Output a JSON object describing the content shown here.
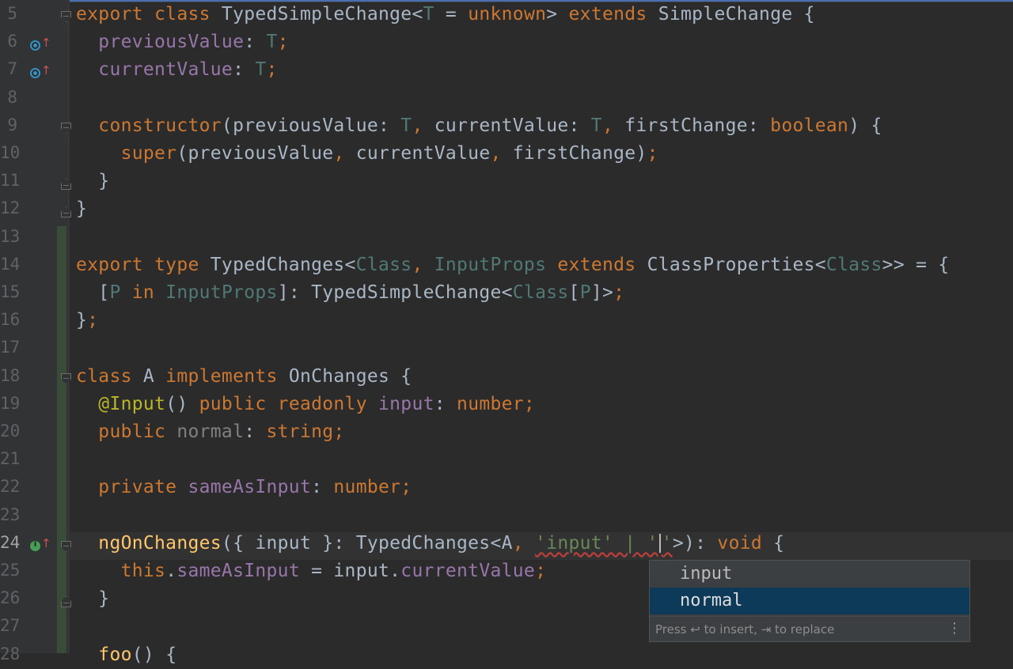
{
  "editor": {
    "lines": [
      {
        "n": "5",
        "tokens": [
          [
            "kw",
            "export class "
          ],
          [
            "cls",
            "TypedSimpleChange"
          ],
          [
            "",
            "<"
          ],
          [
            "tp",
            "T"
          ],
          [
            "",
            " = "
          ],
          [
            "kw",
            "unknown"
          ],
          [
            "",
            "> "
          ],
          [
            "kw",
            "extends "
          ],
          [
            "cls",
            "SimpleChange {"
          ]
        ]
      },
      {
        "n": "6",
        "tokens": [
          [
            "",
            "  "
          ],
          [
            "fld",
            "previousValue"
          ],
          [
            "",
            ": "
          ],
          [
            "tp",
            "T"
          ],
          [
            "kw",
            ";"
          ]
        ]
      },
      {
        "n": "7",
        "tokens": [
          [
            "",
            "  "
          ],
          [
            "fld",
            "currentValue"
          ],
          [
            "",
            ": "
          ],
          [
            "tp",
            "T"
          ],
          [
            "kw",
            ";"
          ]
        ]
      },
      {
        "n": "8",
        "tokens": []
      },
      {
        "n": "9",
        "tokens": [
          [
            "",
            "  "
          ],
          [
            "kw",
            "constructor"
          ],
          [
            "",
            "(previousValue: "
          ],
          [
            "tp",
            "T"
          ],
          [
            "kw",
            ", "
          ],
          [
            "",
            "currentValue: "
          ],
          [
            "tp",
            "T"
          ],
          [
            "kw",
            ", "
          ],
          [
            "",
            "firstChange: "
          ],
          [
            "kw",
            "boolean"
          ],
          [
            "",
            ") {"
          ]
        ]
      },
      {
        "n": "10",
        "tokens": [
          [
            "",
            "    "
          ],
          [
            "kw",
            "super"
          ],
          [
            "",
            "(previousValue"
          ],
          [
            "kw",
            ", "
          ],
          [
            "",
            "currentValue"
          ],
          [
            "kw",
            ", "
          ],
          [
            "",
            "firstChange)"
          ],
          [
            "kw",
            ";"
          ]
        ]
      },
      {
        "n": "11",
        "tokens": [
          [
            "",
            "  }"
          ]
        ]
      },
      {
        "n": "12",
        "tokens": [
          [
            "",
            "}"
          ]
        ]
      },
      {
        "n": "13",
        "tokens": []
      },
      {
        "n": "14",
        "tokens": [
          [
            "kw",
            "export type "
          ],
          [
            "",
            "TypedChanges<"
          ],
          [
            "tp",
            "Class"
          ],
          [
            "kw",
            ", "
          ],
          [
            "tp",
            "InputProps "
          ],
          [
            "kw",
            "extends "
          ],
          [
            "",
            "ClassProperties<"
          ],
          [
            "tp",
            "Class"
          ],
          [
            "",
            ">> = {"
          ]
        ]
      },
      {
        "n": "15",
        "tokens": [
          [
            "",
            "  ["
          ],
          [
            "tp",
            "P "
          ],
          [
            "kw",
            "in "
          ],
          [
            "tp",
            "InputProps"
          ],
          [
            "",
            "]: TypedSimpleChange<"
          ],
          [
            "tp",
            "Class"
          ],
          [
            "",
            "["
          ],
          [
            "tp",
            "P"
          ],
          [
            "",
            "]>"
          ],
          [
            "kw",
            ";"
          ]
        ]
      },
      {
        "n": "16",
        "tokens": [
          [
            "",
            "}"
          ],
          [
            "kw",
            ";"
          ]
        ]
      },
      {
        "n": "17",
        "tokens": []
      },
      {
        "n": "18",
        "tokens": [
          [
            "kw",
            "class "
          ],
          [
            "",
            "A "
          ],
          [
            "kw",
            "implements "
          ],
          [
            "",
            "OnChanges {"
          ]
        ]
      },
      {
        "n": "19",
        "tokens": [
          [
            "",
            "  "
          ],
          [
            "ann",
            "@Input"
          ],
          [
            "",
            "() "
          ],
          [
            "kw",
            "public readonly "
          ],
          [
            "fld",
            "input"
          ],
          [
            "",
            ": "
          ],
          [
            "kw",
            "number;"
          ]
        ]
      },
      {
        "n": "20",
        "tokens": [
          [
            "",
            "  "
          ],
          [
            "kw",
            "public "
          ],
          [
            "dim",
            "normal"
          ],
          [
            "",
            ": "
          ],
          [
            "kw",
            "string;"
          ]
        ]
      },
      {
        "n": "21",
        "tokens": []
      },
      {
        "n": "22",
        "tokens": [
          [
            "",
            "  "
          ],
          [
            "kw",
            "private "
          ],
          [
            "fld",
            "sameAsInput"
          ],
          [
            "",
            ": "
          ],
          [
            "kw",
            "number;"
          ]
        ]
      },
      {
        "n": "23",
        "tokens": []
      },
      {
        "n": "24",
        "tokens": [
          [
            "",
            "  "
          ],
          [
            "fn",
            "ngOnChanges"
          ],
          [
            "",
            "({ input }: TypedChanges<A"
          ],
          [
            "kw",
            ", "
          ],
          [
            "str err",
            "'input' | ''"
          ],
          [
            "",
            ">)"
          ],
          [
            "",
            ": "
          ],
          [
            "kw",
            "void "
          ],
          [
            "",
            "{"
          ]
        ]
      },
      {
        "n": "25",
        "tokens": [
          [
            "",
            "    "
          ],
          [
            "kw",
            "this"
          ],
          [
            "",
            "."
          ],
          [
            "fld",
            "sameAsInput"
          ],
          [
            "",
            " = input."
          ],
          [
            "fld",
            "currentValue"
          ],
          [
            "kw",
            ";"
          ]
        ]
      },
      {
        "n": "26",
        "tokens": [
          [
            "",
            "  }"
          ]
        ]
      },
      {
        "n": "27",
        "tokens": []
      },
      {
        "n": "28",
        "tokens": [
          [
            "",
            "  "
          ],
          [
            "fn",
            "foo"
          ],
          [
            "",
            "() {"
          ]
        ]
      }
    ]
  },
  "completion": {
    "items": [
      "input",
      "normal"
    ],
    "selected_index": 1,
    "footer": "Press ↩ to insert, ⇥ to replace",
    "menu_icon": "more-vertical-icon"
  },
  "colors": {
    "background": "#2b2b2b",
    "keyword": "#cc7832",
    "field": "#9876aa",
    "type_param": "#507874",
    "string": "#6a8759",
    "function": "#ffc66d",
    "selection": "#0d3a58"
  }
}
